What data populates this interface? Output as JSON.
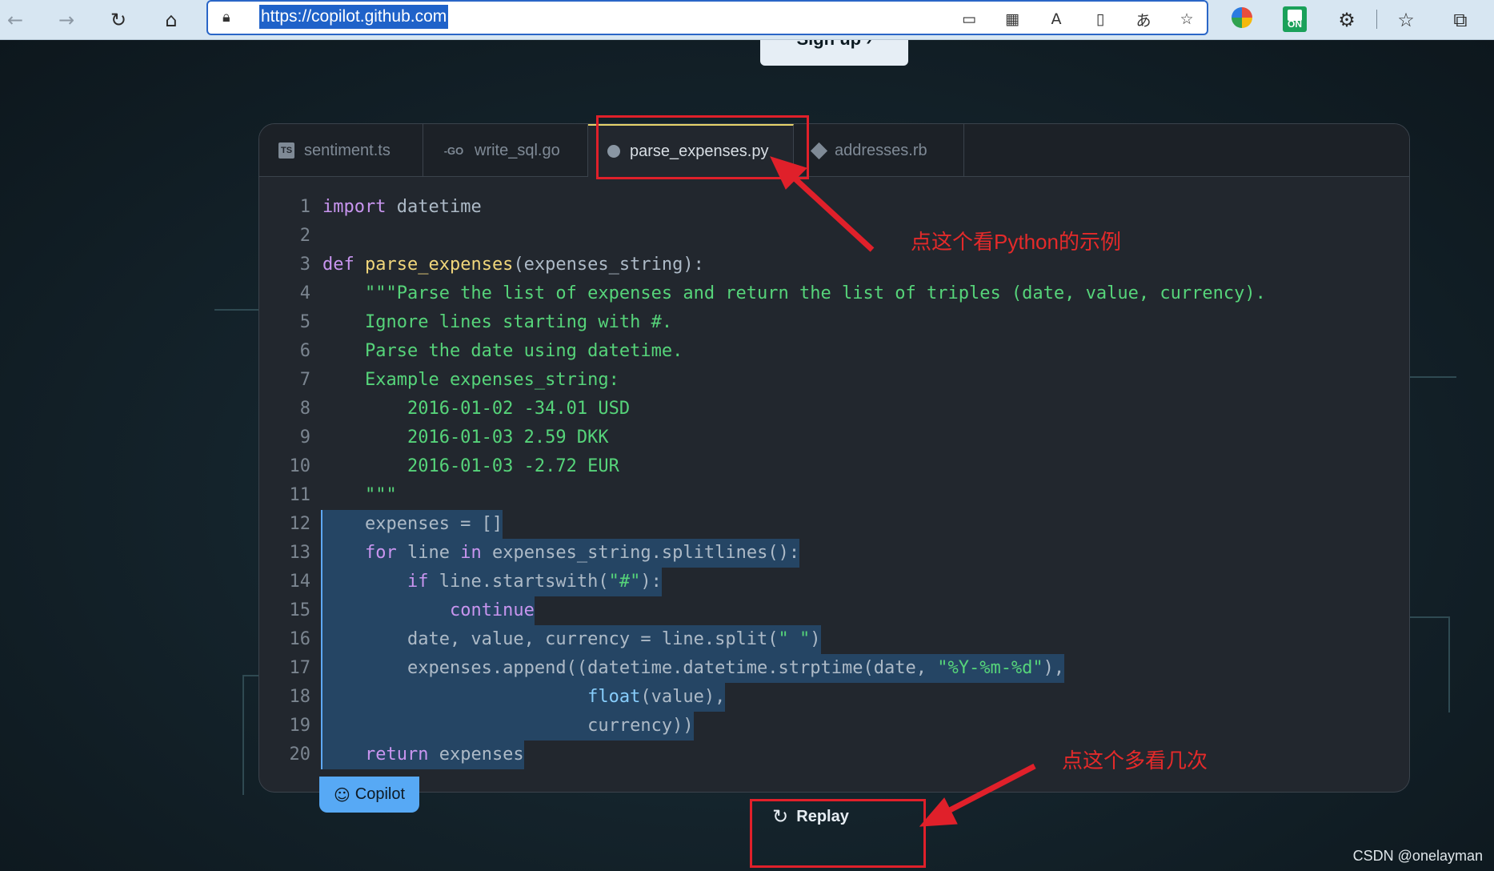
{
  "browser": {
    "url": "https://copilot.github.com",
    "ext_badge": "ON"
  },
  "page": {
    "signup_label": "Sign up ›",
    "tabs": [
      {
        "label": "sentiment.ts",
        "icon": "TS"
      },
      {
        "label": "write_sql.go",
        "icon": "-GO"
      },
      {
        "label": "parse_expenses.py"
      },
      {
        "label": "addresses.rb"
      }
    ],
    "code_lines": [
      {
        "n": "1",
        "parts": [
          {
            "t": "import",
            "c": "kw"
          },
          {
            "t": " datetime",
            "c": "pl"
          }
        ]
      },
      {
        "n": "2",
        "parts": []
      },
      {
        "n": "3",
        "parts": [
          {
            "t": "def",
            "c": "kw"
          },
          {
            "t": " ",
            "c": "pl"
          },
          {
            "t": "parse_expenses",
            "c": "fn"
          },
          {
            "t": "(expenses_string):",
            "c": "pl"
          }
        ]
      },
      {
        "n": "4",
        "parts": [
          {
            "t": "    \"\"\"Parse the list of expenses and return the list of triples (date, value, currency).",
            "c": "str"
          }
        ]
      },
      {
        "n": "5",
        "parts": [
          {
            "t": "    Ignore lines starting with #.",
            "c": "str"
          }
        ]
      },
      {
        "n": "6",
        "parts": [
          {
            "t": "    Parse the date using datetime.",
            "c": "str"
          }
        ]
      },
      {
        "n": "7",
        "parts": [
          {
            "t": "    Example expenses_string:",
            "c": "str"
          }
        ]
      },
      {
        "n": "8",
        "parts": [
          {
            "t": "        2016-01-02 -34.01 USD",
            "c": "str"
          }
        ]
      },
      {
        "n": "9",
        "parts": [
          {
            "t": "        2016-01-03 2.59 DKK",
            "c": "str"
          }
        ]
      },
      {
        "n": "10",
        "parts": [
          {
            "t": "        2016-01-03 -2.72 EUR",
            "c": "str"
          }
        ]
      },
      {
        "n": "11",
        "parts": [
          {
            "t": "    \"\"\"",
            "c": "str"
          }
        ]
      },
      {
        "n": "12",
        "hl": true,
        "parts": [
          {
            "t": "    expenses = []",
            "c": "pl"
          }
        ]
      },
      {
        "n": "13",
        "hl": true,
        "parts": [
          {
            "t": "    ",
            "c": "pl"
          },
          {
            "t": "for",
            "c": "kw"
          },
          {
            "t": " line ",
            "c": "pl"
          },
          {
            "t": "in",
            "c": "kw"
          },
          {
            "t": " expenses_string.splitlines():",
            "c": "pl"
          }
        ]
      },
      {
        "n": "14",
        "hl": true,
        "parts": [
          {
            "t": "        ",
            "c": "pl"
          },
          {
            "t": "if",
            "c": "kw"
          },
          {
            "t": " line.startswith(",
            "c": "pl"
          },
          {
            "t": "\"#\"",
            "c": "str"
          },
          {
            "t": "):",
            "c": "pl"
          }
        ]
      },
      {
        "n": "15",
        "hl": true,
        "parts": [
          {
            "t": "            ",
            "c": "pl"
          },
          {
            "t": "continue",
            "c": "kw"
          }
        ]
      },
      {
        "n": "16",
        "hl": true,
        "parts": [
          {
            "t": "        date, value, currency = line.split(",
            "c": "pl"
          },
          {
            "t": "\" \"",
            "c": "str"
          },
          {
            "t": ")",
            "c": "pl"
          }
        ]
      },
      {
        "n": "17",
        "hl": true,
        "parts": [
          {
            "t": "        expenses.append((datetime.datetime.strptime(date, ",
            "c": "pl"
          },
          {
            "t": "\"%Y-%m-%d\"",
            "c": "str"
          },
          {
            "t": "),",
            "c": "pl"
          }
        ]
      },
      {
        "n": "18",
        "hl": true,
        "parts": [
          {
            "t": "                         ",
            "c": "pl"
          },
          {
            "t": "float",
            "c": "bi"
          },
          {
            "t": "(value),",
            "c": "pl"
          }
        ]
      },
      {
        "n": "19",
        "hl": true,
        "parts": [
          {
            "t": "                         currency))",
            "c": "pl"
          }
        ]
      },
      {
        "n": "20",
        "hl": true,
        "parts": [
          {
            "t": "    ",
            "c": "pl"
          },
          {
            "t": "return",
            "c": "kw"
          },
          {
            "t": " expenses",
            "c": "pl"
          }
        ]
      }
    ],
    "copilot_label": "Copilot",
    "replay_label": "Replay"
  },
  "annotations": {
    "tab_note": "点这个看Python的示例",
    "replay_note": "点这个多看几次",
    "color": "#e0202a"
  },
  "watermark": "CSDN @onelayman"
}
